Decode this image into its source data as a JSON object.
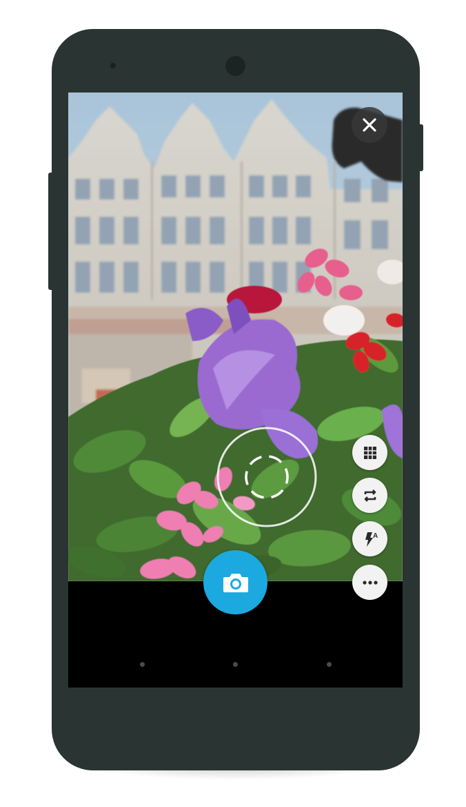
{
  "device": {
    "frame_color": "#2a3433"
  },
  "camera": {
    "close_icon": "close-icon",
    "focus_icon": "focus-ring-icon",
    "controls": [
      {
        "id": "grid",
        "icon": "grid-icon"
      },
      {
        "id": "switch_camera",
        "icon": "switch-camera-icon"
      },
      {
        "id": "flash_auto",
        "icon": "flash-auto-icon",
        "badge": "A"
      },
      {
        "id": "more",
        "icon": "more-options-icon"
      }
    ],
    "shutter": {
      "icon": "camera-icon",
      "color": "#1ba9e0"
    }
  },
  "nav_bar": {
    "dots": 3
  }
}
